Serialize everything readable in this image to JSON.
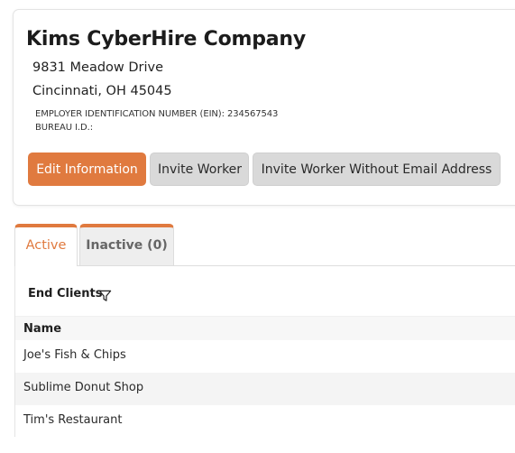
{
  "company": {
    "name": "Kims CyberHire Company",
    "address_line1": "9831 Meadow Drive",
    "address_line2": "Cincinnati, OH 45045",
    "ein_line": "EMPLOYER IDENTIFICATION NUMBER (EIN): 234567543",
    "bureau_line": "BUREAU I.D.:"
  },
  "actions": {
    "edit_label": "Edit Information",
    "invite_label": "Invite Worker",
    "invite_no_email_label": "Invite Worker Without Email Address"
  },
  "tabs": [
    {
      "label": "Active",
      "selected": true
    },
    {
      "label": "Inactive (0)",
      "selected": false
    }
  ],
  "end_clients": {
    "title": "End Clients",
    "filter_icon": "filter-icon",
    "column_header": "Name",
    "rows": [
      "Joe's Fish & Chips",
      "Sublime Donut Shop",
      "Tim's Restaurant"
    ]
  },
  "colors": {
    "accent": "#e07a3f",
    "secondary_button": "#d9d9d9",
    "row_alt": "#f4f4f4"
  }
}
